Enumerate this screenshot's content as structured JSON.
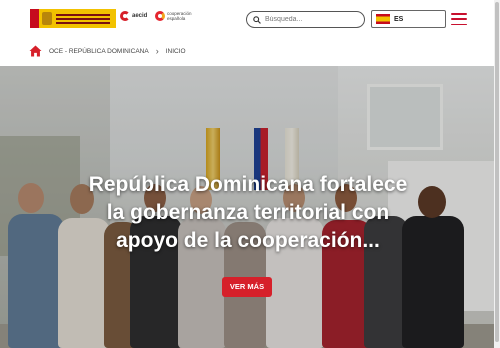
{
  "header": {
    "gov_logo": "gobierno-de-espana-logo",
    "aecid_label": "aecid",
    "coop_label": "cooperación española",
    "search": {
      "placeholder": "Búsqueda...",
      "value": ""
    },
    "language": {
      "code": "ES",
      "flag": "spain-flag-icon"
    },
    "menu_icon": "hamburger-menu-icon"
  },
  "breadcrumb": {
    "home_icon": "home-icon",
    "items": [
      "OCE - REPÚBLICA DOMINICANA",
      "INICIO"
    ],
    "separator": "›"
  },
  "hero": {
    "title_lines": [
      "República Dominicana fortalece",
      "la gobernanza territorial con",
      "apoyo de la cooperación..."
    ],
    "cta_label": "VER MÁS"
  },
  "colors": {
    "accent": "#d6202a",
    "menu": "#c8102e",
    "title_text": "#ffffff"
  }
}
